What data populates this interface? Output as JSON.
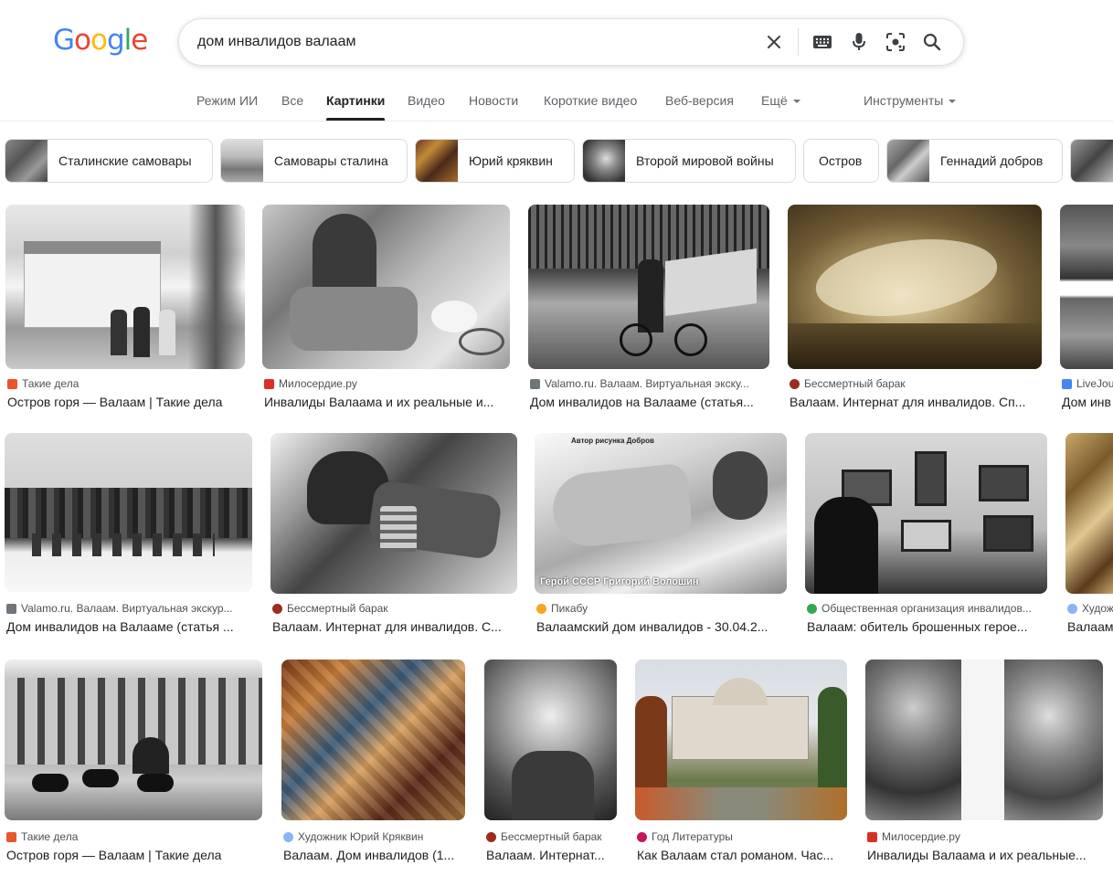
{
  "logo": {
    "letters": [
      "G",
      "o",
      "o",
      "g",
      "l",
      "e"
    ],
    "colors": [
      "#4285f4",
      "#ea4335",
      "#fbbc05",
      "#4285f4",
      "#34a853",
      "#ea4335"
    ]
  },
  "search": {
    "value": "дом инвалидов валаам"
  },
  "tabs": [
    {
      "label": "Режим ИИ"
    },
    {
      "label": "Все"
    },
    {
      "label": "Картинки",
      "active": true
    },
    {
      "label": "Видео"
    },
    {
      "label": "Новости"
    },
    {
      "label": "Короткие видео"
    },
    {
      "label": "Веб-версия"
    },
    {
      "label": "Ещё"
    }
  ],
  "tools": {
    "label": "Инструменты"
  },
  "chips": [
    {
      "label": "Сталинские самовары"
    },
    {
      "label": "Самовары сталина"
    },
    {
      "label": "Юрий кряквин"
    },
    {
      "label": "Второй мировой войны"
    },
    {
      "label": "Остров"
    },
    {
      "label": "Геннадий добров"
    }
  ],
  "results": [
    {
      "source": "Такие дела",
      "title": "Остров горя — Валаам | Такие дела",
      "fav_color": "#e8562a"
    },
    {
      "source": "Милосердие.ру",
      "title": "Инвалиды Валаама и их реальные и...",
      "fav_color": "#d93025"
    },
    {
      "source": "Valamo.ru. Валаам. Виртуальная экску...",
      "title": "Дом инвалидов на Валааме (статья...",
      "fav_color": "#70757a"
    },
    {
      "source": "Бессмертный барак",
      "title": "Валаам. Интернат для инвалидов. Сп...",
      "fav_color": "#9b2c1f"
    },
    {
      "source": "LiveJou",
      "title": "Дом инв",
      "fav_color": "#4285f4"
    },
    {
      "source": "Valamo.ru. Валаам. Виртуальная экскур...",
      "title": "Дом инвалидов на Валааме (статья ...",
      "fav_color": "#70757a"
    },
    {
      "source": "Бессмертный барак",
      "title": "Валаам. Интернат для инвалидов. С...",
      "fav_color": "#9b2c1f"
    },
    {
      "source": "Пикабу",
      "title": "Валаамский дом инвалидов - 30.04.2...",
      "fav_color": "#f6a623"
    },
    {
      "source": "Общественная организация инвалидов...",
      "title": "Валаам: обитель брошенных герое...",
      "fav_color": "#34a853"
    },
    {
      "source": "Худож",
      "title": "Валаам",
      "fav_color": "#8ab4f8"
    },
    {
      "source": "Такие дела",
      "title": "Остров горя — Валаам | Такие дела",
      "fav_color": "#e8562a"
    },
    {
      "source": "Художник Юрий Кряквин",
      "title": "Валаам. Дом инвалидов (1...",
      "fav_color": "#8ab4f8"
    },
    {
      "source": "Бессмертный барак",
      "title": "Валаам. Интернат...",
      "fav_color": "#9b2c1f"
    },
    {
      "source": "Год Литературы",
      "title": "Как Валаам стал романом. Час...",
      "fav_color": "#c2185b"
    },
    {
      "source": "Милосердие.ру",
      "title": "Инвалиды Валаама и их реальные...",
      "fav_color": "#d93025"
    }
  ],
  "overlays": {
    "pikabu_top": "Автор рисунка Добров",
    "pikabu_caption": "Герой СССР Григорий Волошин"
  }
}
